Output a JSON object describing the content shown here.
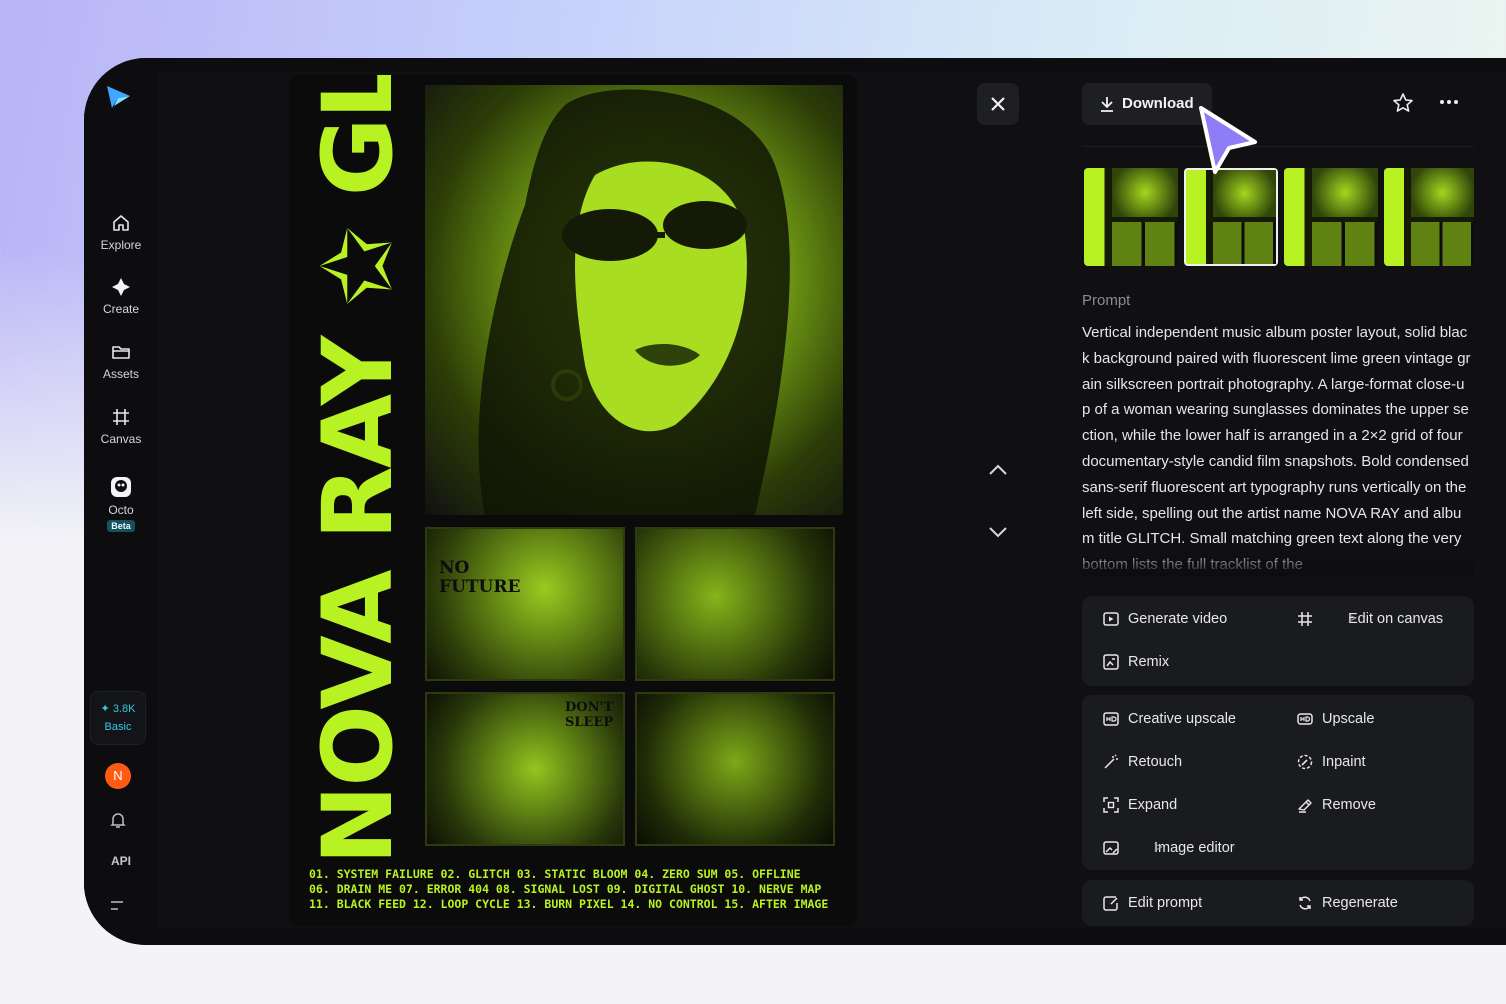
{
  "sidebar": {
    "items": [
      {
        "label": "Explore",
        "icon": "home-icon"
      },
      {
        "label": "Create",
        "icon": "sparkle-icon"
      },
      {
        "label": "Assets",
        "icon": "folder-icon"
      },
      {
        "label": "Canvas",
        "icon": "canvas-icon"
      },
      {
        "label": "Octo",
        "icon": "octo-icon",
        "badge": "Beta"
      }
    ],
    "credits": {
      "amount": "3.8K",
      "plan": "Basic"
    },
    "avatar_initial": "N",
    "api_label": "API"
  },
  "poster": {
    "vertical_title": "NOVA RAY ✩ GLITCH",
    "snapshot_texts": [
      "NO FUTURE",
      "DON'T SLEEP"
    ],
    "tracklist": [
      "01. SYSTEM FAILURE  02. GLITCH  03. STATIC BLOOM  04. ZERO SUM  05. OFFLINE",
      "06. DRAIN ME  07. ERROR 404  08. SIGNAL LOST  09. DIGITAL GHOST  10. NERVE MAP",
      "11. BLACK FEED  12. LOOP CYCLE  13. BURN PIXEL  14. NO CONTROL  15. AFTER IMAGE"
    ]
  },
  "panel": {
    "download_label": "Download",
    "prompt_label": "Prompt",
    "prompt_text": "Vertical independent music album poster layout, solid black background paired with fluorescent lime green vintage grain silkscreen portrait photography. A large-format close-up of a woman wearing sunglasses dominates the upper section, while the lower half is arranged in a 2×2 grid of four documentary-style candid film snapshots. Bold condensed sans-serif fluorescent art typography runs vertically on the left side, spelling out the artist name NOVA RAY and album title GLITCH. Small matching green text along the very bottom lists the full tracklist of the",
    "actions_group1": [
      {
        "label": "Generate video",
        "icon": "play-icon"
      },
      {
        "label": "Edit on canvas",
        "icon": "canvas-icon",
        "chevron": ">"
      },
      {
        "label": "Remix",
        "icon": "remix-icon"
      }
    ],
    "actions_group2": [
      {
        "label": "Creative upscale",
        "icon": "hd-plus-icon"
      },
      {
        "label": "Upscale",
        "icon": "hd-icon"
      },
      {
        "label": "Retouch",
        "icon": "wand-icon"
      },
      {
        "label": "Inpaint",
        "icon": "inpaint-icon"
      },
      {
        "label": "Expand",
        "icon": "expand-icon"
      },
      {
        "label": "Remove",
        "icon": "eraser-icon"
      },
      {
        "label": "Image editor",
        "icon": "image-edit-icon",
        "chevron": ">"
      }
    ],
    "actions_group3": [
      {
        "label": "Edit prompt",
        "icon": "edit-icon"
      },
      {
        "label": "Regenerate",
        "icon": "refresh-icon"
      }
    ]
  },
  "colors": {
    "accent_green": "#b9f222",
    "cursor_purple": "#8f7cf7",
    "credits_cyan": "#35c8e4",
    "avatar_orange": "#ff5a12"
  }
}
